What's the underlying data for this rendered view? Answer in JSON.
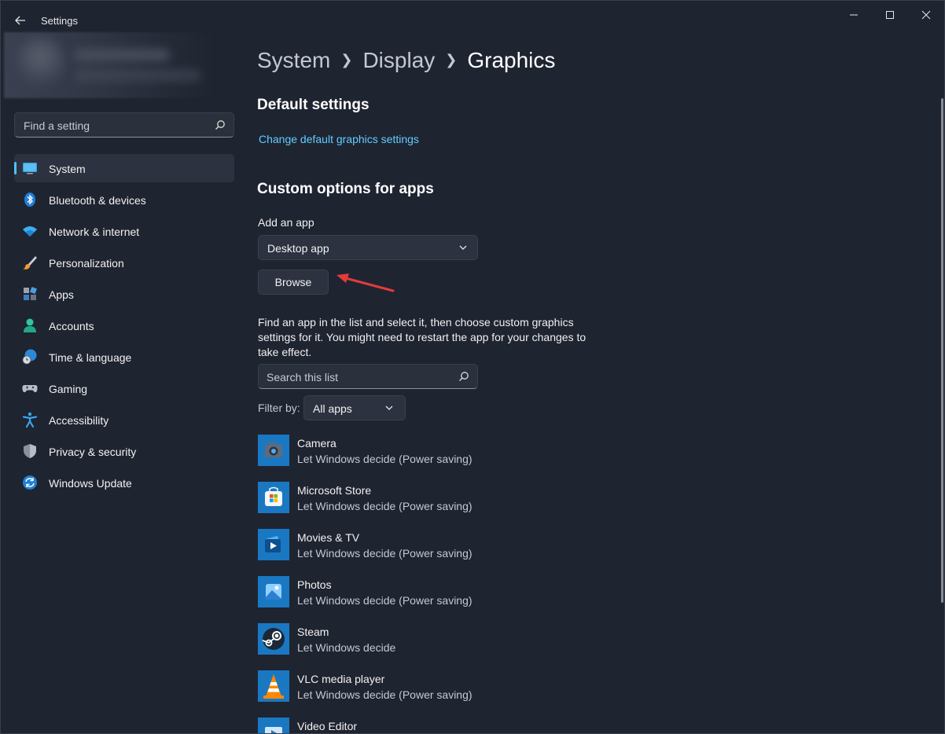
{
  "window": {
    "title": "Settings"
  },
  "sidebar": {
    "search_placeholder": "Find a setting",
    "items": [
      {
        "label": "System",
        "icon": "system-icon",
        "active": true
      },
      {
        "label": "Bluetooth & devices",
        "icon": "bluetooth-icon"
      },
      {
        "label": "Network & internet",
        "icon": "wifi-icon"
      },
      {
        "label": "Personalization",
        "icon": "brush-icon"
      },
      {
        "label": "Apps",
        "icon": "apps-icon"
      },
      {
        "label": "Accounts",
        "icon": "person-icon"
      },
      {
        "label": "Time & language",
        "icon": "globe-clock-icon"
      },
      {
        "label": "Gaming",
        "icon": "gamepad-icon"
      },
      {
        "label": "Accessibility",
        "icon": "accessibility-icon"
      },
      {
        "label": "Privacy & security",
        "icon": "shield-icon"
      },
      {
        "label": "Windows Update",
        "icon": "update-icon"
      }
    ]
  },
  "breadcrumb": {
    "items": [
      "System",
      "Display",
      "Graphics"
    ]
  },
  "main": {
    "default_heading": "Default settings",
    "default_link": "Change default graphics settings",
    "custom_heading": "Custom options for apps",
    "add_app_label": "Add an app",
    "app_type_value": "Desktop app",
    "browse_label": "Browse",
    "description": "Find an app in the list and select it, then choose custom graphics settings for it. You might need to restart the app for your changes to take effect.",
    "list_search_placeholder": "Search this list",
    "filter_label": "Filter by:",
    "filter_value": "All apps"
  },
  "apps": [
    {
      "name": "Camera",
      "setting": "Let Windows decide (Power saving)",
      "icon": "camera-icon"
    },
    {
      "name": "Microsoft Store",
      "setting": "Let Windows decide (Power saving)",
      "icon": "store-icon"
    },
    {
      "name": "Movies & TV",
      "setting": "Let Windows decide (Power saving)",
      "icon": "movies-icon"
    },
    {
      "name": "Photos",
      "setting": "Let Windows decide (Power saving)",
      "icon": "photos-icon"
    },
    {
      "name": "Steam",
      "setting": "Let Windows decide",
      "icon": "steam-icon"
    },
    {
      "name": "VLC media player",
      "setting": "Let Windows decide (Power saving)",
      "icon": "vlc-icon"
    },
    {
      "name": "Video Editor",
      "setting": "",
      "icon": "video-editor-icon"
    }
  ],
  "colors": {
    "accent": "#4cc2ff",
    "link": "#60cdff",
    "background": "#1f2431",
    "annotation_arrow": "#e23b3b"
  }
}
